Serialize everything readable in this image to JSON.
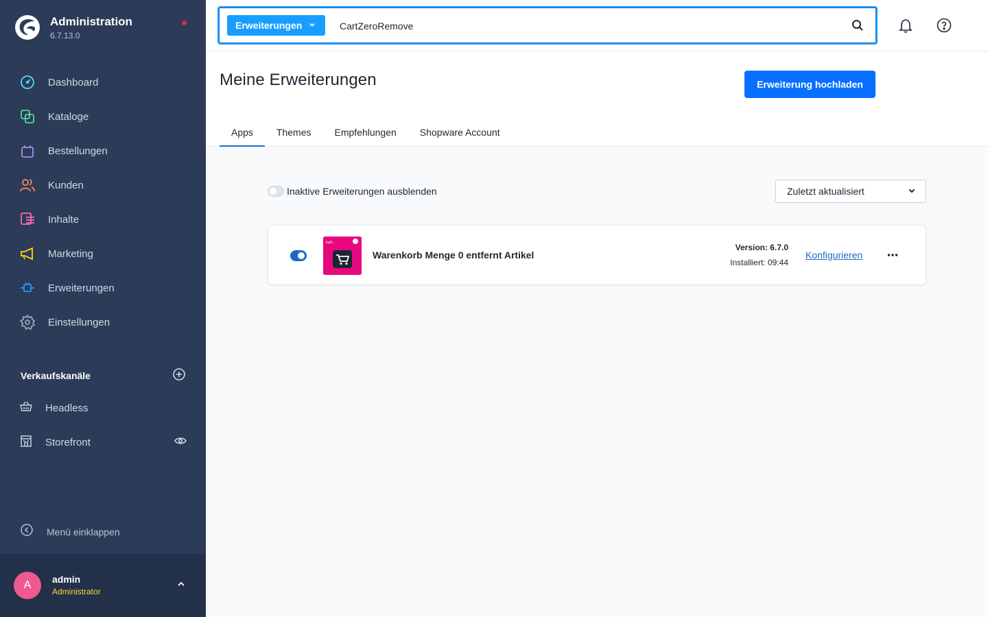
{
  "brand": {
    "title": "Administration",
    "version": "6.7.13.0"
  },
  "nav": [
    {
      "label": "Dashboard",
      "color": "#57d9f3"
    },
    {
      "label": "Kataloge",
      "color": "#57d9a3"
    },
    {
      "label": "Bestellungen",
      "color": "#a092f0"
    },
    {
      "label": "Kunden",
      "color": "#f88962"
    },
    {
      "label": "Inhalte",
      "color": "#ff68b4"
    },
    {
      "label": "Marketing",
      "color": "#ffd700"
    },
    {
      "label": "Erweiterungen",
      "color": "#189eff"
    },
    {
      "label": "Einstellungen",
      "color": "#9aa8b5"
    }
  ],
  "sales_channels": {
    "title": "Verkaufskanäle",
    "items": [
      {
        "label": "Headless"
      },
      {
        "label": "Storefront"
      }
    ]
  },
  "collapse_label": "Menü einklappen",
  "user": {
    "initial": "A",
    "name": "admin",
    "role": "Administrator"
  },
  "search": {
    "type_label": "Erweiterungen",
    "value": "CartZeroRemove"
  },
  "page": {
    "title": "Meine Erweiterungen",
    "upload_label": "Erweiterung hochladen",
    "tabs": [
      "Apps",
      "Themes",
      "Empfehlungen",
      "Shopware Account"
    ],
    "active_tab": "Apps"
  },
  "filter": {
    "hide_inactive_label": "Inaktive Erweiterungen ausblenden",
    "hide_inactive_on": false,
    "sort_value": "Zuletzt aktualisiert"
  },
  "extension": {
    "name": "Warenkorb Menge 0 entfernt Artikel",
    "version": "Version: 6.7.0",
    "installed": "Installiert: 09:44",
    "configure_label": "Konfigurieren",
    "active": true,
    "icon_text": "loyfi..."
  },
  "colors": {
    "sidebar": "#2c3b58",
    "accent": "#189eff",
    "primary_button": "#0870ff",
    "link": "#1e69c8",
    "extension_icon_bg": "#e7087f",
    "avatar": "#ee5a8f",
    "role": "#ffd33d"
  }
}
